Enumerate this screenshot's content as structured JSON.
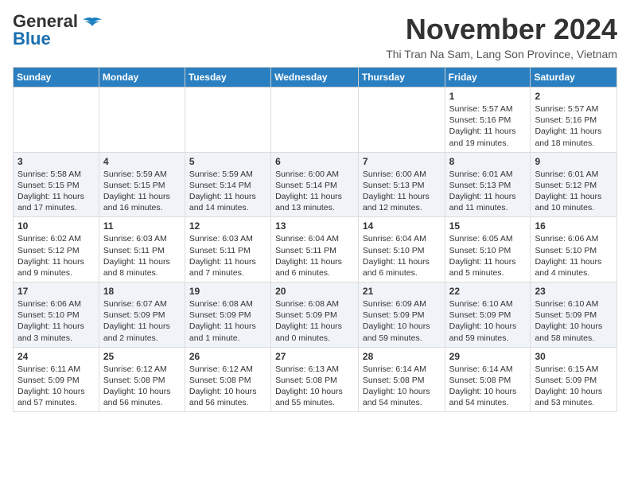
{
  "header": {
    "logo_general": "General",
    "logo_blue": "Blue",
    "month": "November 2024",
    "location": "Thi Tran Na Sam, Lang Son Province, Vietnam"
  },
  "weekdays": [
    "Sunday",
    "Monday",
    "Tuesday",
    "Wednesday",
    "Thursday",
    "Friday",
    "Saturday"
  ],
  "weeks": [
    [
      {
        "day": "",
        "content": ""
      },
      {
        "day": "",
        "content": ""
      },
      {
        "day": "",
        "content": ""
      },
      {
        "day": "",
        "content": ""
      },
      {
        "day": "",
        "content": ""
      },
      {
        "day": "1",
        "content": "Sunrise: 5:57 AM\nSunset: 5:16 PM\nDaylight: 11 hours and 19 minutes."
      },
      {
        "day": "2",
        "content": "Sunrise: 5:57 AM\nSunset: 5:16 PM\nDaylight: 11 hours and 18 minutes."
      }
    ],
    [
      {
        "day": "3",
        "content": "Sunrise: 5:58 AM\nSunset: 5:15 PM\nDaylight: 11 hours and 17 minutes."
      },
      {
        "day": "4",
        "content": "Sunrise: 5:59 AM\nSunset: 5:15 PM\nDaylight: 11 hours and 16 minutes."
      },
      {
        "day": "5",
        "content": "Sunrise: 5:59 AM\nSunset: 5:14 PM\nDaylight: 11 hours and 14 minutes."
      },
      {
        "day": "6",
        "content": "Sunrise: 6:00 AM\nSunset: 5:14 PM\nDaylight: 11 hours and 13 minutes."
      },
      {
        "day": "7",
        "content": "Sunrise: 6:00 AM\nSunset: 5:13 PM\nDaylight: 11 hours and 12 minutes."
      },
      {
        "day": "8",
        "content": "Sunrise: 6:01 AM\nSunset: 5:13 PM\nDaylight: 11 hours and 11 minutes."
      },
      {
        "day": "9",
        "content": "Sunrise: 6:01 AM\nSunset: 5:12 PM\nDaylight: 11 hours and 10 minutes."
      }
    ],
    [
      {
        "day": "10",
        "content": "Sunrise: 6:02 AM\nSunset: 5:12 PM\nDaylight: 11 hours and 9 minutes."
      },
      {
        "day": "11",
        "content": "Sunrise: 6:03 AM\nSunset: 5:11 PM\nDaylight: 11 hours and 8 minutes."
      },
      {
        "day": "12",
        "content": "Sunrise: 6:03 AM\nSunset: 5:11 PM\nDaylight: 11 hours and 7 minutes."
      },
      {
        "day": "13",
        "content": "Sunrise: 6:04 AM\nSunset: 5:11 PM\nDaylight: 11 hours and 6 minutes."
      },
      {
        "day": "14",
        "content": "Sunrise: 6:04 AM\nSunset: 5:10 PM\nDaylight: 11 hours and 6 minutes."
      },
      {
        "day": "15",
        "content": "Sunrise: 6:05 AM\nSunset: 5:10 PM\nDaylight: 11 hours and 5 minutes."
      },
      {
        "day": "16",
        "content": "Sunrise: 6:06 AM\nSunset: 5:10 PM\nDaylight: 11 hours and 4 minutes."
      }
    ],
    [
      {
        "day": "17",
        "content": "Sunrise: 6:06 AM\nSunset: 5:10 PM\nDaylight: 11 hours and 3 minutes."
      },
      {
        "day": "18",
        "content": "Sunrise: 6:07 AM\nSunset: 5:09 PM\nDaylight: 11 hours and 2 minutes."
      },
      {
        "day": "19",
        "content": "Sunrise: 6:08 AM\nSunset: 5:09 PM\nDaylight: 11 hours and 1 minute."
      },
      {
        "day": "20",
        "content": "Sunrise: 6:08 AM\nSunset: 5:09 PM\nDaylight: 11 hours and 0 minutes."
      },
      {
        "day": "21",
        "content": "Sunrise: 6:09 AM\nSunset: 5:09 PM\nDaylight: 10 hours and 59 minutes."
      },
      {
        "day": "22",
        "content": "Sunrise: 6:10 AM\nSunset: 5:09 PM\nDaylight: 10 hours and 59 minutes."
      },
      {
        "day": "23",
        "content": "Sunrise: 6:10 AM\nSunset: 5:09 PM\nDaylight: 10 hours and 58 minutes."
      }
    ],
    [
      {
        "day": "24",
        "content": "Sunrise: 6:11 AM\nSunset: 5:09 PM\nDaylight: 10 hours and 57 minutes."
      },
      {
        "day": "25",
        "content": "Sunrise: 6:12 AM\nSunset: 5:08 PM\nDaylight: 10 hours and 56 minutes."
      },
      {
        "day": "26",
        "content": "Sunrise: 6:12 AM\nSunset: 5:08 PM\nDaylight: 10 hours and 56 minutes."
      },
      {
        "day": "27",
        "content": "Sunrise: 6:13 AM\nSunset: 5:08 PM\nDaylight: 10 hours and 55 minutes."
      },
      {
        "day": "28",
        "content": "Sunrise: 6:14 AM\nSunset: 5:08 PM\nDaylight: 10 hours and 54 minutes."
      },
      {
        "day": "29",
        "content": "Sunrise: 6:14 AM\nSunset: 5:08 PM\nDaylight: 10 hours and 54 minutes."
      },
      {
        "day": "30",
        "content": "Sunrise: 6:15 AM\nSunset: 5:09 PM\nDaylight: 10 hours and 53 minutes."
      }
    ]
  ]
}
